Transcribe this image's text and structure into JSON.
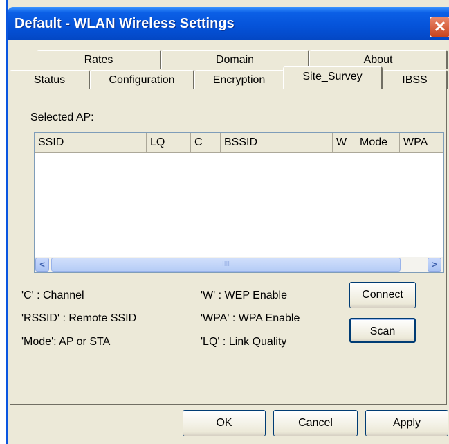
{
  "window": {
    "title": "Default - WLAN Wireless Settings",
    "close_glyph": "✕"
  },
  "tabs_top": [
    "Rates",
    "Domain",
    "About"
  ],
  "tabs_bottom": [
    "Status",
    "Configuration",
    "Encryption",
    "Site_Survey",
    "IBSS"
  ],
  "active_tab": "Site_Survey",
  "site_survey": {
    "selected_ap_label": "Selected AP:",
    "columns": [
      "SSID",
      "LQ",
      "C",
      "BSSID",
      "W",
      "Mode",
      "WPA"
    ],
    "rows": [],
    "legend": {
      "channel": "'C' : Channel",
      "rssid": "'RSSID' : Remote SSID",
      "mode": "'Mode': AP or STA",
      "wep": "'W' : WEP Enable",
      "wpa": "'WPA' : WPA Enable",
      "lq": "'LQ' : Link Quality"
    },
    "connect_label": "Connect",
    "scan_label": "Scan",
    "scroll_left_glyph": "<",
    "scroll_right_glyph": ">",
    "scroll_grip": "IIII"
  },
  "footer": {
    "ok_label": "OK",
    "cancel_label": "Cancel",
    "apply_label": "Apply"
  },
  "colors": {
    "titlebar": "#0552d8",
    "face": "#ece9d8",
    "close": "#c9431d"
  }
}
